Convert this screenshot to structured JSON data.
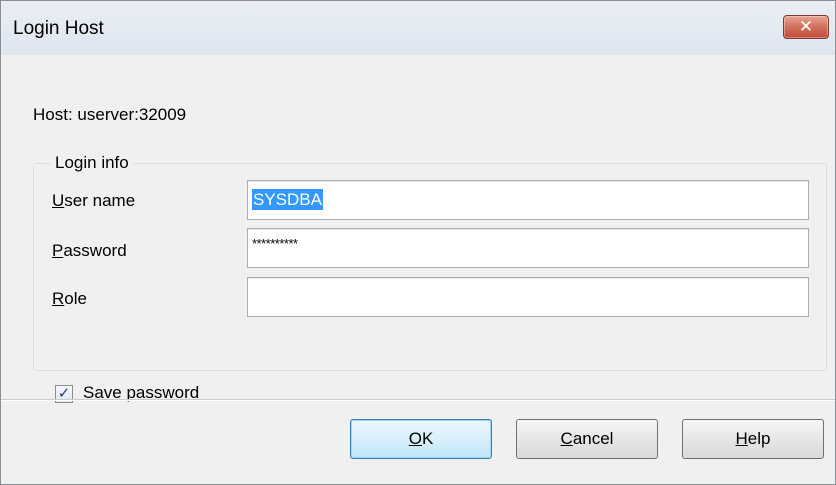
{
  "window": {
    "title": "Login Host",
    "close_glyph": "✕"
  },
  "host": {
    "label": "Host:",
    "value": "userver:32009"
  },
  "group": {
    "legend": "Login info"
  },
  "fields": {
    "username": {
      "label_first": "U",
      "label_rest": "ser name",
      "value": "SYSDBA"
    },
    "password": {
      "label_first": "P",
      "label_rest": "assword",
      "value": "**********"
    },
    "role": {
      "label_first": "R",
      "label_rest": "ole",
      "value": ""
    }
  },
  "save_password": {
    "checked": true,
    "check_glyph": "✓",
    "label": "Save password"
  },
  "buttons": {
    "ok": {
      "first": "O",
      "rest": "K"
    },
    "cancel": {
      "first": "C",
      "rest": "ancel"
    },
    "help": {
      "first": "H",
      "rest": "elp"
    }
  }
}
